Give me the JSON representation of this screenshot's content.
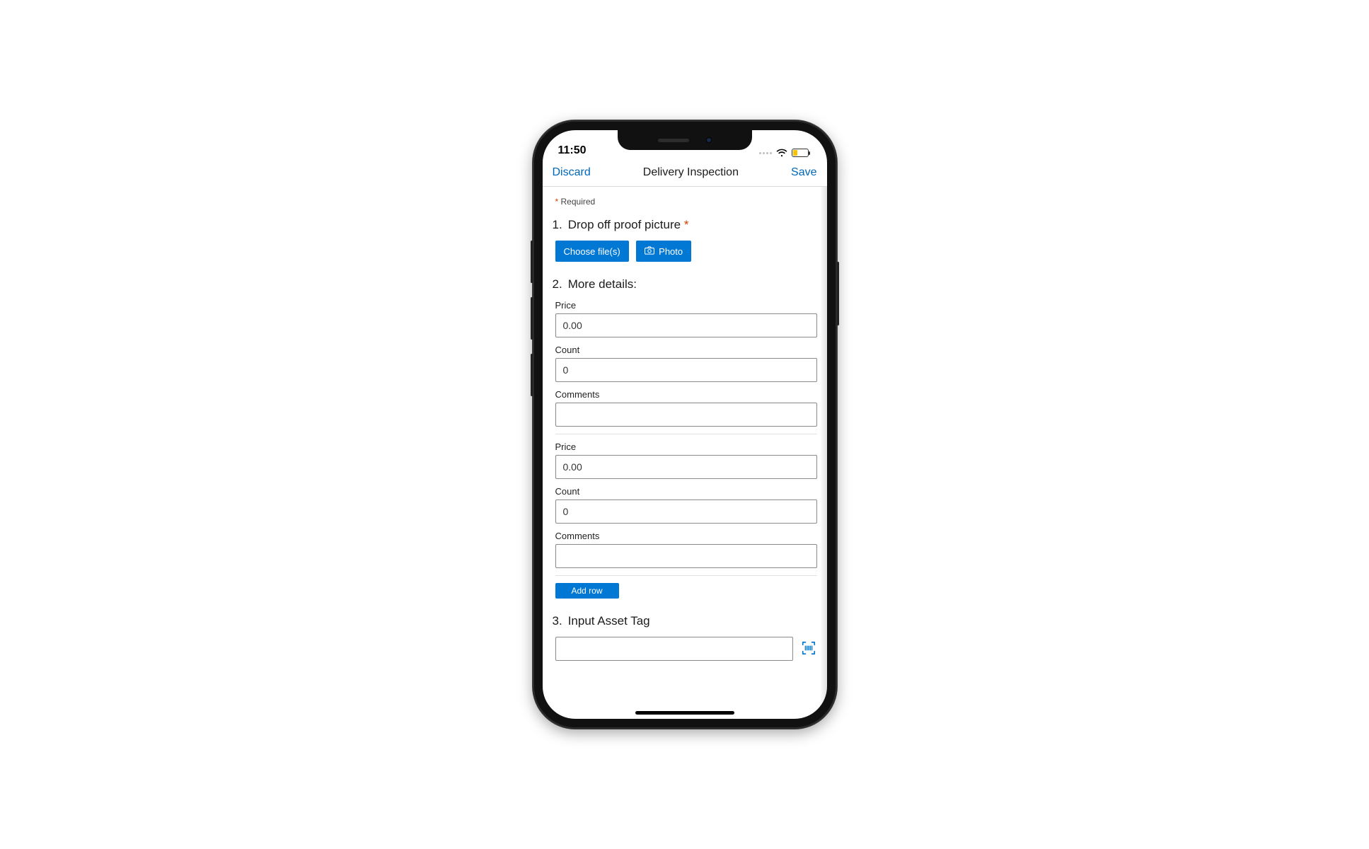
{
  "status": {
    "time": "11:50"
  },
  "nav": {
    "discard": "Discard",
    "title": "Delivery Inspection",
    "save": "Save"
  },
  "required_label": "Required",
  "q1": {
    "num": "1.",
    "title": "Drop off proof picture",
    "choose": "Choose file(s)",
    "photo": "Photo"
  },
  "q2": {
    "num": "2.",
    "title": "More details:",
    "labels": {
      "price": "Price",
      "count": "Count",
      "comments": "Comments"
    },
    "rows": [
      {
        "price": "0.00",
        "count": "0",
        "comments": ""
      },
      {
        "price": "0.00",
        "count": "0",
        "comments": ""
      }
    ],
    "add_row": "Add row"
  },
  "q3": {
    "num": "3.",
    "title": "Input Asset Tag",
    "value": ""
  }
}
